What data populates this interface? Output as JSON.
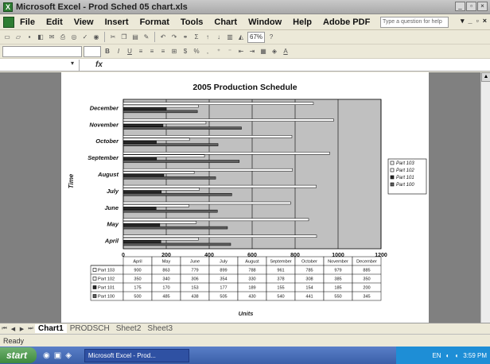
{
  "window": {
    "title": "Microsoft Excel - Prod Sched 05 chart.xls",
    "minimize": "_",
    "restore": "▫",
    "close": "×"
  },
  "menu": {
    "items": [
      "File",
      "Edit",
      "View",
      "Insert",
      "Format",
      "Tools",
      "Chart",
      "Window",
      "Help",
      "Adobe PDF"
    ],
    "help_placeholder": "Type a question for help"
  },
  "toolbar": {
    "zoom": "67%"
  },
  "formula_bar": {
    "fx": "fx"
  },
  "chart_data": {
    "type": "bar",
    "title": "2005 Production Schedule",
    "ylabel": "Time",
    "xlabel": "Units",
    "xlim": [
      0,
      1200
    ],
    "x_ticks": [
      "0",
      "200",
      "400",
      "600",
      "800",
      "1000",
      "1200"
    ],
    "categories": [
      "April",
      "May",
      "June",
      "July",
      "August",
      "September",
      "October",
      "November",
      "December"
    ],
    "category_labels": [
      "April",
      "May",
      "June",
      "July",
      "August",
      "September",
      "October",
      "November",
      "December"
    ],
    "table_headers": [
      "April",
      "May",
      "June",
      "July",
      "August",
      "September",
      "October",
      "November",
      "December"
    ],
    "series": [
      {
        "name": "Part 100",
        "values": [
          500,
          485,
          438,
          505,
          430,
          540,
          441,
          550,
          345
        ],
        "color": "#606060"
      },
      {
        "name": "Part 101",
        "values": [
          175,
          170,
          153,
          177,
          189,
          155,
          154,
          185,
          200
        ],
        "color": "#2a2a2a"
      },
      {
        "name": "Part 102",
        "values": [
          350,
          340,
          306,
          354,
          330,
          378,
          308,
          385,
          350
        ],
        "color": "#ffffff"
      },
      {
        "name": "Part 103",
        "values": [
          900,
          863,
          779,
          899,
          788,
          961,
          785,
          979,
          885
        ],
        "color": "#ffffff"
      }
    ],
    "legend_position": "right",
    "grid": true
  },
  "sheets": {
    "tabs": [
      "Chart1",
      "PRODSCH",
      "Sheet2",
      "Sheet3"
    ],
    "active": "Chart1"
  },
  "status": {
    "text": "Ready"
  },
  "taskbar": {
    "start": "start",
    "task": "Microsoft Excel - Prod...",
    "lang": "EN",
    "time": "3:59 PM"
  }
}
